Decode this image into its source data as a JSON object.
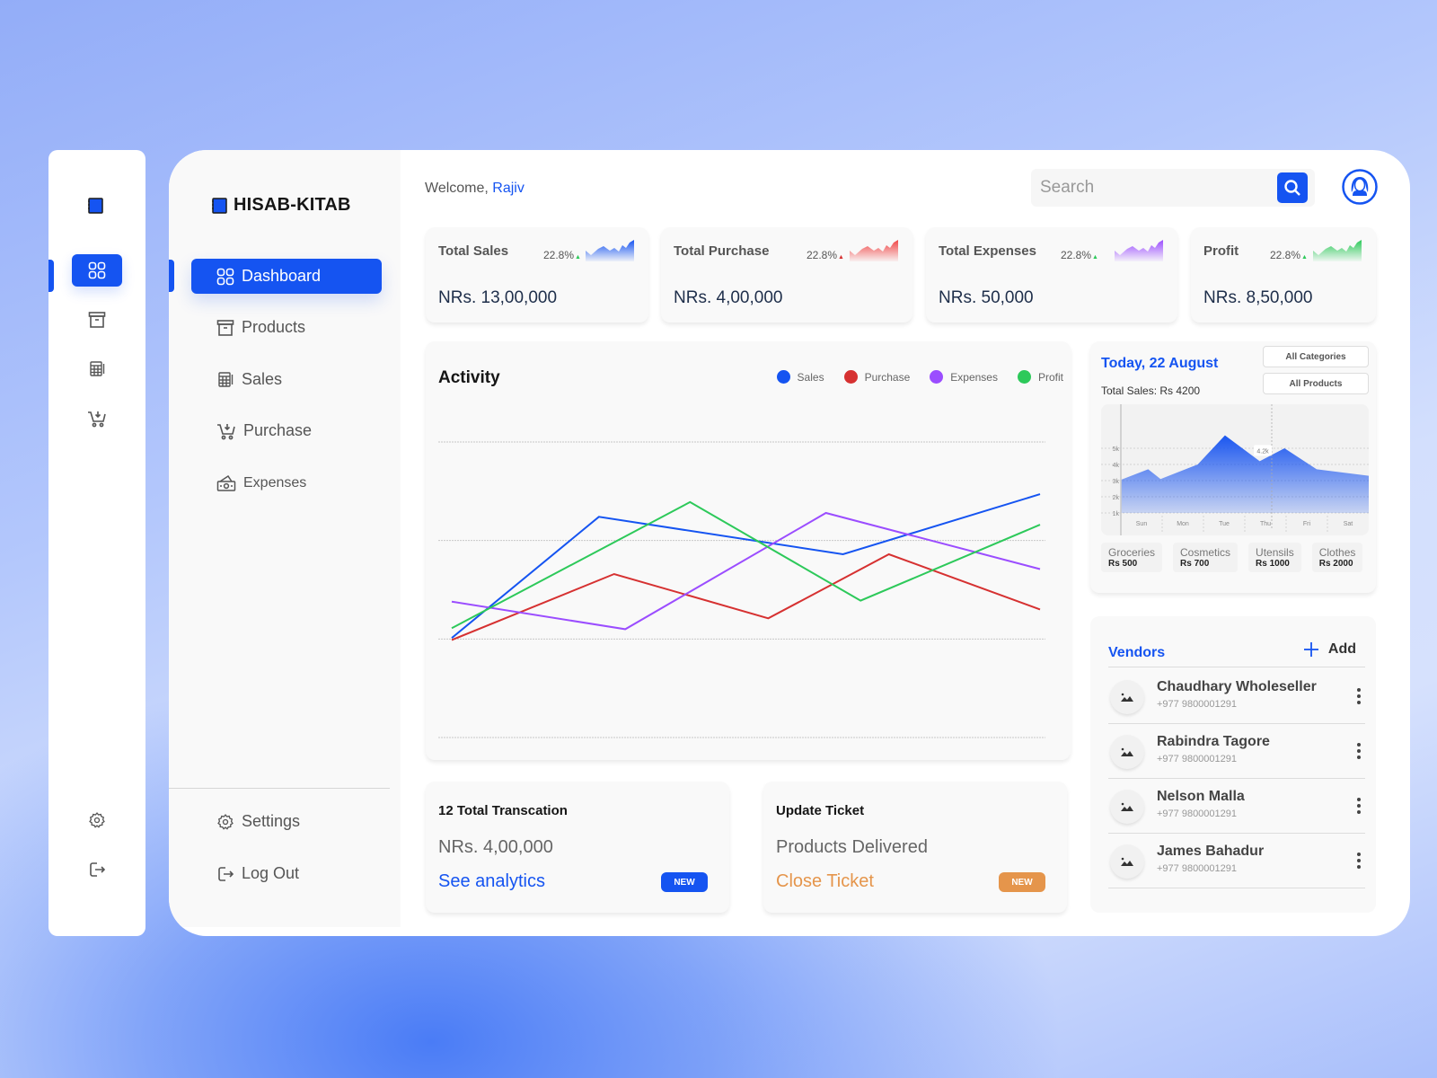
{
  "app": {
    "brand": "HISAB-KITAB"
  },
  "colors": {
    "accent": "#1554f1",
    "sales": "#1554f1",
    "purchase": "#d63131",
    "expenses": "#9b4dff",
    "profit": "#2dc95a",
    "orange": "#e5954b"
  },
  "rail": {
    "items": [
      {
        "icon": "grid-icon",
        "active": true
      },
      {
        "icon": "archive-box-icon"
      },
      {
        "icon": "calculator-icon"
      },
      {
        "icon": "cart-icon"
      },
      {
        "icon": "gear-icon"
      },
      {
        "icon": "logout-icon"
      }
    ]
  },
  "sidebar": {
    "items": [
      {
        "label": "Dashboard",
        "icon": "grid-icon",
        "active": true
      },
      {
        "label": "Products",
        "icon": "archive-box-icon"
      },
      {
        "label": "Sales",
        "icon": "calculator-icon"
      },
      {
        "label": "Purchase",
        "icon": "cart-icon"
      },
      {
        "label": "Expenses",
        "icon": "cash-icon"
      }
    ],
    "bottom": [
      {
        "label": "Settings",
        "icon": "gear-icon"
      },
      {
        "label": "Log Out",
        "icon": "logout-icon"
      }
    ]
  },
  "header": {
    "welcome_prefix": "Welcome,",
    "user_name": "Rajiv",
    "search_placeholder": "Search"
  },
  "stats": [
    {
      "label": "Total Sales",
      "change": "22.8%",
      "trend": "up",
      "value": "NRs. 13,00,000",
      "color": "#1554f1"
    },
    {
      "label": "Total Purchase",
      "change": "22.8%",
      "trend": "up",
      "value": "NRs. 4,00,000",
      "color": "#f04545"
    },
    {
      "label": "Total Expenses",
      "change": "22.8%",
      "trend": "up",
      "value": "NRs. 50,000",
      "color": "#9b4dff"
    },
    {
      "label": "Profit",
      "change": "22.8%",
      "trend": "up",
      "value": "NRs. 8,50,000",
      "color": "#2dc95a"
    }
  ],
  "activity": {
    "title": "Activity",
    "legend": [
      "Sales",
      "Purchase",
      "Expenses",
      "Profit"
    ]
  },
  "chart_data": [
    {
      "type": "line",
      "title": "Activity",
      "xlabel": "",
      "ylabel": "",
      "xlim": [
        0,
        100
      ],
      "ylim": [
        0,
        300
      ],
      "grid": true,
      "legend_position": "top-right",
      "series": [
        {
          "name": "Sales",
          "color": "#1554f1",
          "points": [
            [
              0,
              101
            ],
            [
              25,
              224
            ],
            [
              66.5,
              186
            ],
            [
              100,
              247
            ]
          ]
        },
        {
          "name": "Purchase",
          "color": "#d63131",
          "points": [
            [
              0,
              99
            ],
            [
              27.6,
              166
            ],
            [
              53.8,
              121
            ],
            [
              74.3,
              186
            ],
            [
              100,
              130
            ]
          ]
        },
        {
          "name": "Expenses",
          "color": "#9b4dff",
          "points": [
            [
              0,
              138
            ],
            [
              29.5,
              110
            ],
            [
              63.6,
              228
            ],
            [
              100,
              171
            ]
          ]
        },
        {
          "name": "Profit",
          "color": "#2dc95a",
          "points": [
            [
              0,
              111
            ],
            [
              40.5,
              239
            ],
            [
              69.5,
              139
            ],
            [
              100,
              216
            ]
          ]
        }
      ]
    },
    {
      "type": "area",
      "title": "Total Sales: Rs 4200",
      "categories": [
        "Sun",
        "Mon",
        "Tue",
        "Thu",
        "Fri",
        "Sat"
      ],
      "yticks": [
        "1k",
        "2k",
        "3k",
        "4k",
        "5k"
      ],
      "ylim": [
        1,
        7
      ],
      "grid": true,
      "highlight": {
        "label": "4.2k",
        "value": 4.2
      },
      "points": [
        [
          0,
          3.05
        ],
        [
          11,
          3.7
        ],
        [
          16,
          3.1
        ],
        [
          31,
          4.0
        ],
        [
          42,
          5.8
        ],
        [
          56,
          4.2
        ],
        [
          66,
          5.0
        ],
        [
          79,
          3.7
        ],
        [
          100,
          3.3
        ]
      ]
    }
  ],
  "cards": {
    "transactions": {
      "title": "12 Total Transcation",
      "value": "NRs. 4,00,000",
      "link": "See analytics",
      "badge": "NEW"
    },
    "ticket": {
      "title": "Update Ticket",
      "value": "Products Delivered",
      "link": "Close Ticket",
      "badge": "NEW"
    }
  },
  "today": {
    "date": "Today, 22 August",
    "total_sales": "Total Sales: Rs 4200",
    "filter_category": "All Categories",
    "filter_product": "All Products",
    "categories": [
      {
        "name": "Groceries",
        "amount": "Rs 500"
      },
      {
        "name": "Cosmetics",
        "amount": "Rs 700"
      },
      {
        "name": "Utensils",
        "amount": "Rs 1000"
      },
      {
        "name": "Clothes",
        "amount": "Rs 2000"
      }
    ]
  },
  "vendors": {
    "title": "Vendors",
    "add_label": "Add",
    "items": [
      {
        "name": "Chaudhary Wholeseller",
        "phone": "+977 9800001291"
      },
      {
        "name": "Rabindra Tagore",
        "phone": "+977 9800001291"
      },
      {
        "name": "Nelson Malla",
        "phone": "+977 9800001291"
      },
      {
        "name": "James Bahadur",
        "phone": "+977 9800001291"
      }
    ]
  }
}
